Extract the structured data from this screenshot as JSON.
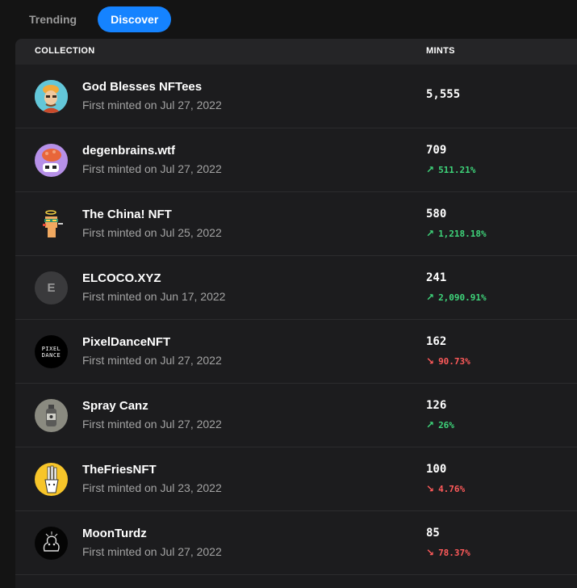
{
  "tabs": [
    {
      "label": "Trending",
      "active": false
    },
    {
      "label": "Discover",
      "active": true
    }
  ],
  "table": {
    "headers": {
      "collection": "COLLECTION",
      "mints": "MINTS"
    },
    "rows": [
      {
        "name": "God Blesses NFTees",
        "first_minted": "First minted on Jul 27, 2022",
        "mints": "5,555",
        "change": "",
        "direction": "",
        "icon": "god-blesses-avatar-icon"
      },
      {
        "name": "degenbrains.wtf",
        "first_minted": "First minted on Jul 27, 2022",
        "mints": "709",
        "change": "511.21%",
        "direction": "up",
        "icon": "degenbrains-avatar-icon"
      },
      {
        "name": "The China! NFT",
        "first_minted": "First minted on Jul 25, 2022",
        "mints": "580",
        "change": "1,218.18%",
        "direction": "up",
        "icon": "china-nft-avatar-icon"
      },
      {
        "name": "ELCOCO.XYZ",
        "first_minted": "First minted on Jun 17, 2022",
        "mints": "241",
        "change": "2,090.91%",
        "direction": "up",
        "icon": "letter-e-avatar-icon",
        "initial": "E"
      },
      {
        "name": "PixelDanceNFT",
        "first_minted": "First minted on Jul 27, 2022",
        "mints": "162",
        "change": "90.73%",
        "direction": "down",
        "icon": "pixeldance-avatar-icon",
        "logo_line1": "PIXEL",
        "logo_line2": "DANCE"
      },
      {
        "name": "Spray Canz",
        "first_minted": "First minted on Jul 27, 2022",
        "mints": "126",
        "change": "26%",
        "direction": "up",
        "icon": "spray-can-avatar-icon"
      },
      {
        "name": "TheFriesNFT",
        "first_minted": "First minted on Jul 23, 2022",
        "mints": "100",
        "change": "4.76%",
        "direction": "down",
        "icon": "fries-avatar-icon"
      },
      {
        "name": "MoonTurdz",
        "first_minted": "First minted on Jul 27, 2022",
        "mints": "85",
        "change": "78.37%",
        "direction": "down",
        "icon": "moonturdz-avatar-icon"
      }
    ]
  },
  "colors": {
    "accent": "#1583ff",
    "up": "#3ed47a",
    "down": "#ff5a5a",
    "background": "#141414",
    "panel": "#1c1c1e"
  },
  "icons": {
    "up": "↗",
    "down": "↘"
  }
}
